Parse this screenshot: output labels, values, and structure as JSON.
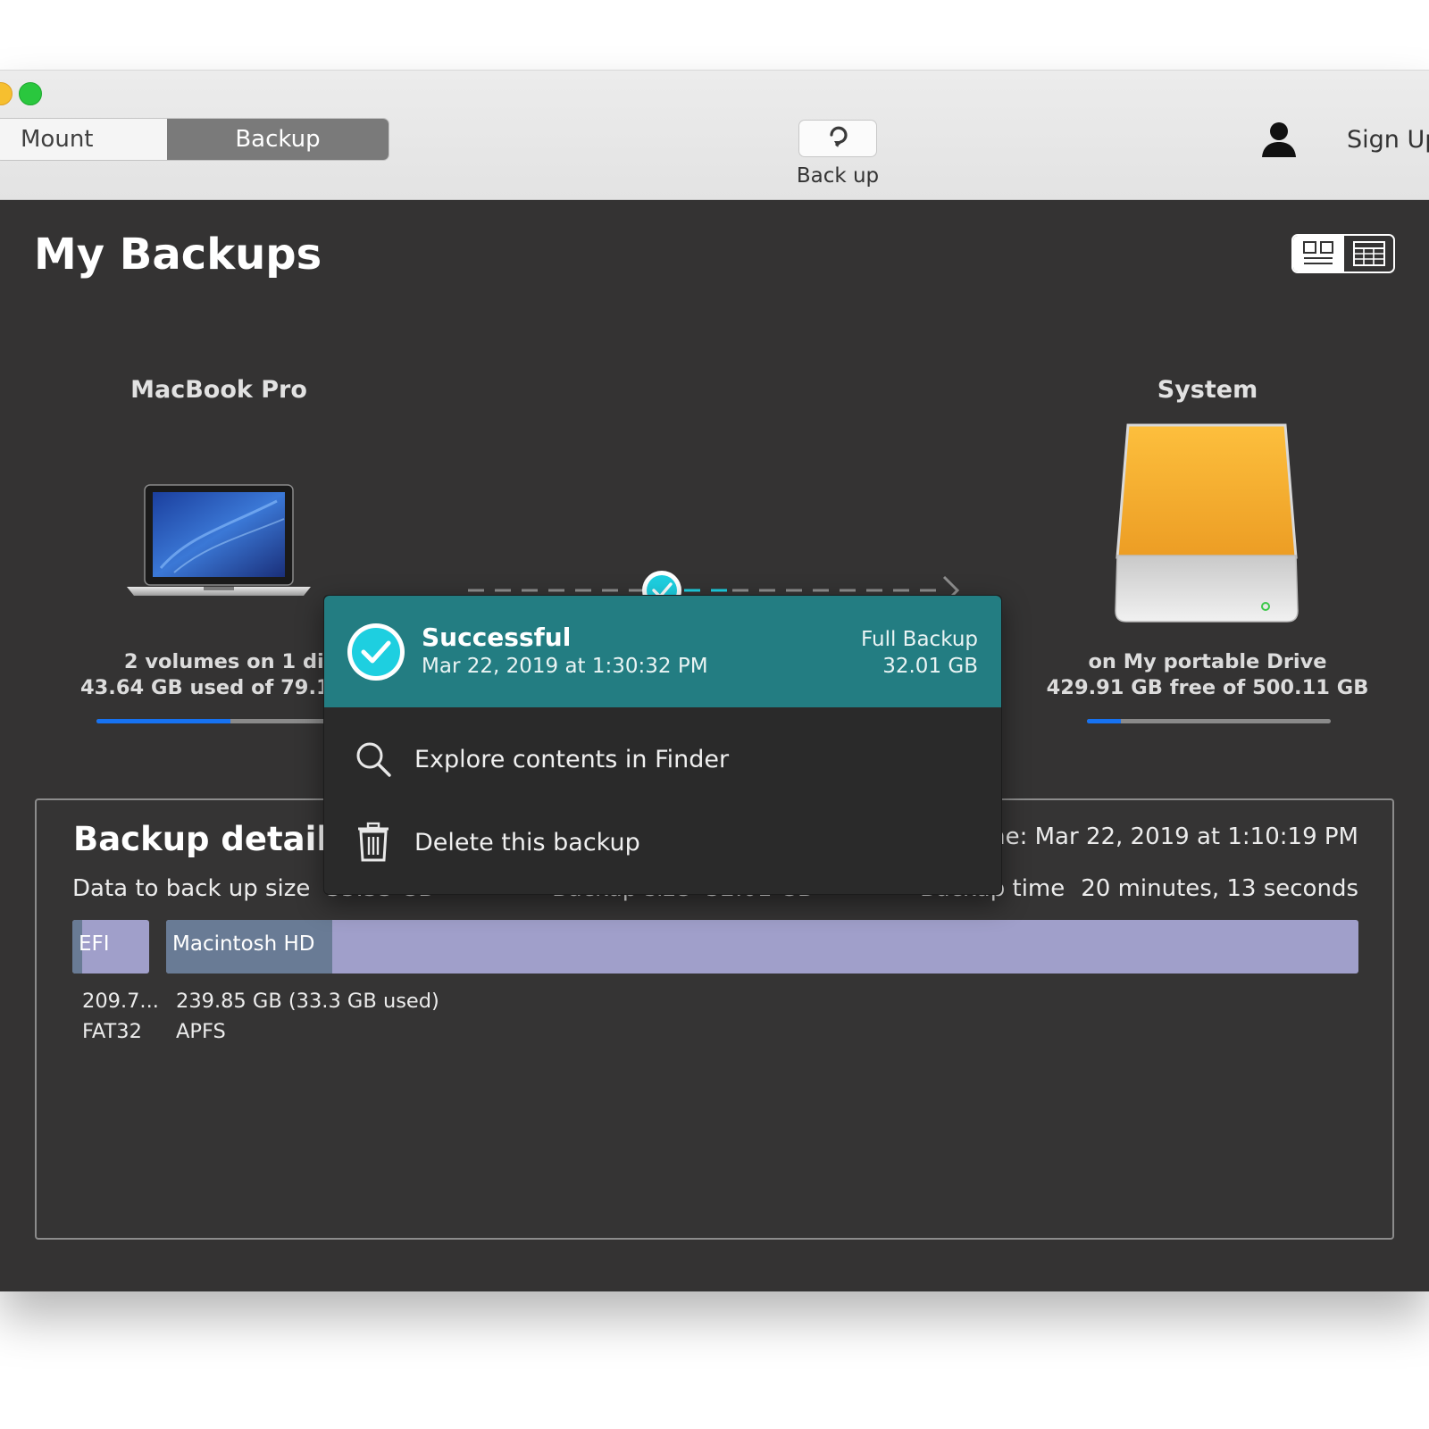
{
  "toolbar": {
    "tabs": [
      {
        "label": "Mount",
        "active": false
      },
      {
        "label": "Backup",
        "active": true
      }
    ],
    "backup_button_label": "Back up",
    "signup_label": "Sign Up"
  },
  "page": {
    "title": "My Backups"
  },
  "source": {
    "name": "MacBook Pro",
    "info_line1": "2 volumes on 1 disk",
    "info_line2": "43.64 GB used of 79.11 GB",
    "usage_fraction": 0.55
  },
  "destination": {
    "name": "System",
    "info_line1": "on My portable Drive",
    "info_line2": "429.91 GB free of 500.11 GB",
    "usage_fraction": 0.14
  },
  "popover": {
    "status": "Successful",
    "date": "Mar 22, 2019 at 1:30:32 PM",
    "type": "Full Backup",
    "size": "32.01 GB",
    "menu": [
      {
        "label": "Explore contents in Finder",
        "icon": "magnifier-icon"
      },
      {
        "label": "Delete this backup",
        "icon": "trash-icon"
      }
    ]
  },
  "details": {
    "title": "Backup details",
    "time_text": "Start time: Mar 22, 2019 at 1:10:19 PM",
    "data_size_label": "Data to back up size",
    "data_size_value": "33.33 GB",
    "backup_size_label": "Backup size",
    "backup_size_value": "32.01 GB",
    "backup_time_label": "Backup time",
    "backup_time_value": "20 minutes, 13 seconds",
    "partitions": [
      {
        "name": "EFI",
        "size": "209.7...",
        "fs": "FAT32",
        "used_fraction": 0.13
      },
      {
        "name": "Macintosh HD",
        "size": "239.85 GB (33.3 GB used)",
        "fs": "APFS",
        "used_fraction": 0.139
      }
    ]
  },
  "colors": {
    "accent_teal": "#237d82",
    "check_cyan": "#1ecfe0",
    "progress_blue": "#1672f2",
    "partition_lavender": "#a09fca"
  }
}
